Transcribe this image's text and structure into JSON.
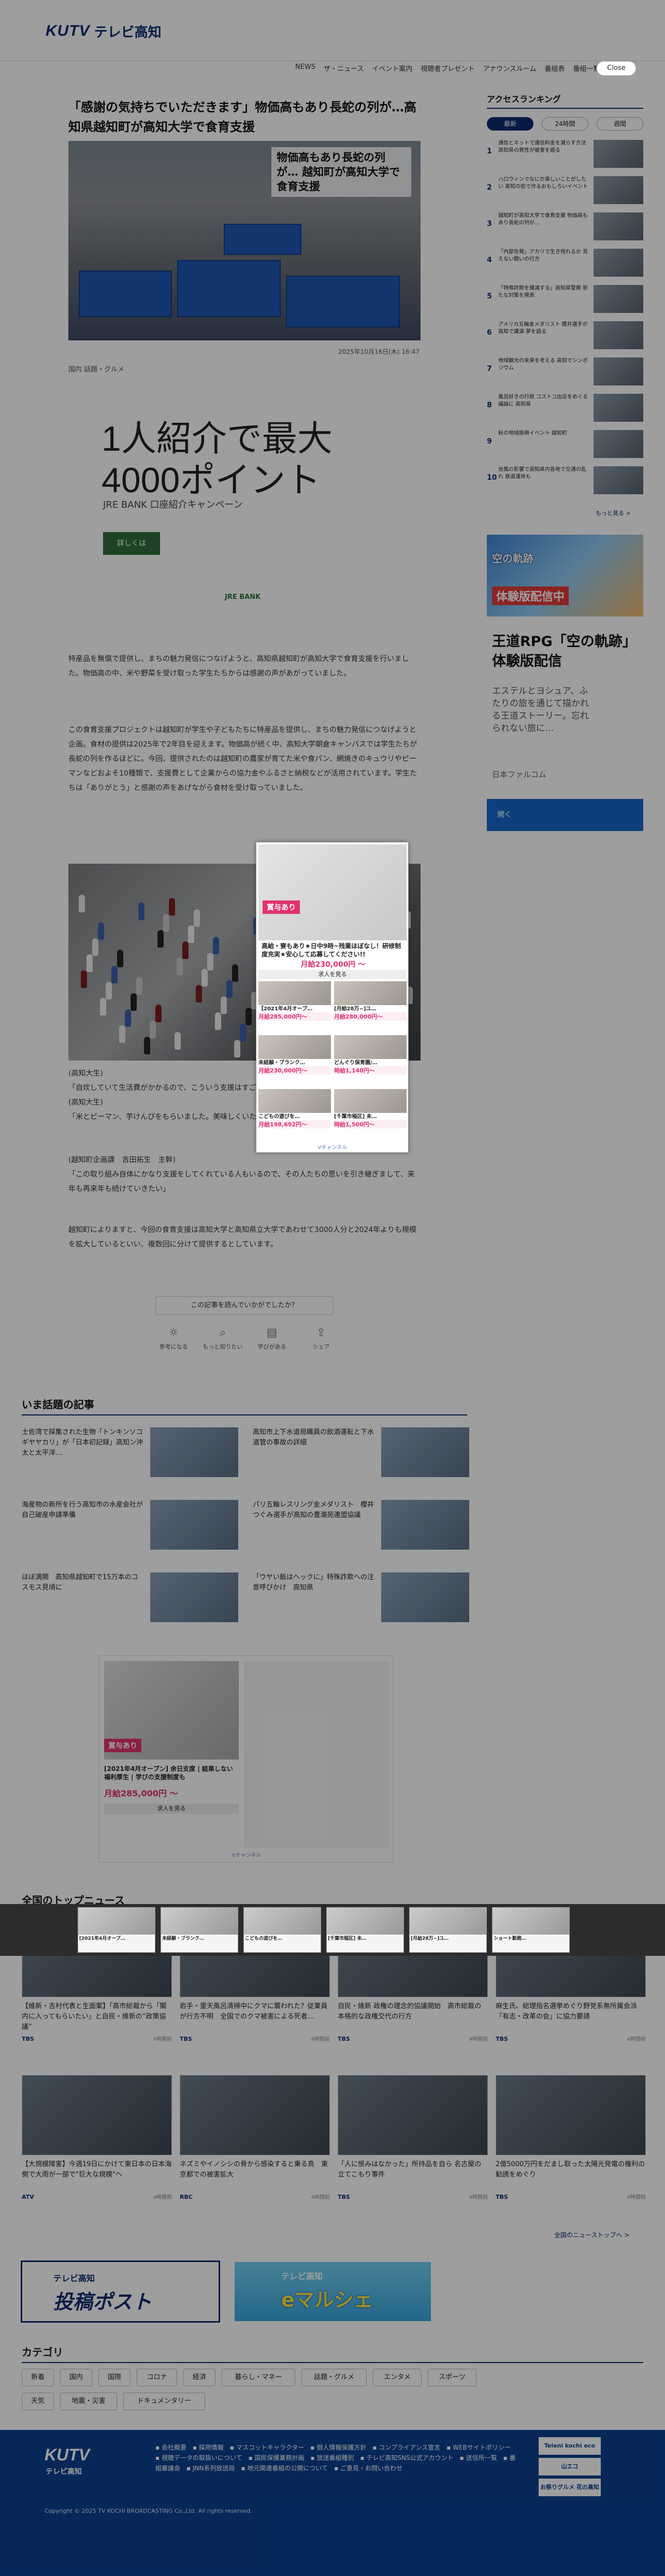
{
  "header": {
    "logo_kutv": "KUTV",
    "logo_name": "テレビ高知",
    "nav": [
      "NEWS",
      "ザ・ニュース",
      "イベント案内",
      "視聴者プレゼント",
      "アナウンスルーム",
      "番組表",
      "番組一覧"
    ],
    "close_label": "Close"
  },
  "article": {
    "title": "「感謝の気持ちでいただきます」物価高もあり長蛇の列が…高知県越知町が高知大学で食育支援",
    "hero_caption": "物価高もあり長蛇の列が… 越知町が高知大学で食育支援",
    "date": "2025年10月16日(木) 16:47",
    "category": "国内 話題・グルメ",
    "paragraphs": [
      "特産品を無償で提供し、まちの魅力発信につなげようと、高知県越知町が高知大学で食育支援を行いました。物価高の中、米や野菜を受け取った学生たちからは感謝の声があがっていました。",
      "この食育支援プロジェクトは越知町が学生や子どもたちに特産品を提供し、まちの魅力発信につなげようと企画。食材の提供は2025年で2年目を迎えます。物価高が続く中、高知大学朝倉キャンパスでは学生たちが長蛇の列を作るほどに。今回、提供されたのは越知町の農家が育てた米や食パン、網焼きのキュウリやピーマンなどおよそ10種類で、支援費として企業からの協力金やふるさと納税などが活用されています。学生たちは「ありがとう」と感謝の声をあげながら食材を受け取っていました。",
      "(高知大生)\n「自炊していて生活費がかかるので、こういう支援はすごく助かります」\n(高知大生)\n「米とピーマン、芋けんぴをもらいました。美味しくいただきます」",
      "(越知町企画課　吉田拓生　主幹)\n「この取り組み自体にかなり支援をしてくれている人もいるので、その人たちの思いを引き継ぎまして、来年も再来年も続けていきたい」",
      "越知町によりますと、今回の食育支援は高知大学と高知県立大学であわせて3000人分と2024年よりも規模を拡大しているといい、複数回に分けて提供するとしています。"
    ],
    "readmore": "この記事を読んでいかがでしたか？",
    "share": [
      "参考になる",
      "もっと知りたい",
      "学びがある",
      "シェア"
    ]
  },
  "ad_main": {
    "headline": "1人紹介で最大\n4000ポイント",
    "sub": "JRE BANK 口座紹介キャンペーン",
    "btn": "詳しくは",
    "foot": "JRE BANK"
  },
  "overlay_ad": {
    "tag": "賞与あり",
    "title": "高給・寮もあり★日中9時~残業ほぼなし！研修制度充実★安心して応募してください!!",
    "price": "月給230,000円 〜",
    "more": "求人を見る",
    "cells": [
      {
        "t": "【2021年4月オープ…",
        "p": "月給285,000円〜"
      },
      {
        "t": "[月給28万~]ユ…",
        "p": "月給280,000円〜"
      },
      {
        "t": "未経験・ブランク…",
        "p": "月給230,000円〜"
      },
      {
        "t": "どんぐり保育園/…",
        "p": "時給1,140円〜"
      },
      {
        "t": "こどもの遊びを…",
        "p": "月給198,692円〜"
      },
      {
        "t": "[千葉市稲区] 未…",
        "p": "時給1,500円〜"
      }
    ],
    "footer": "Vチャンネル"
  },
  "topics": {
    "heading": "いま話題の記事",
    "items": [
      "土佐湾で採集された生物「トンキンソコギヤヤカリ」が「日本初記録」高知ン沖太と太平洋…",
      "高知市上下水道局職員の飲酒運転と下水道管の事故の詳細",
      "海産物の新所を行う高知市の水産会社が自己破産申請準備",
      "パリ五輪レスリング金メダリスト　櫻井つぐみ選手が高知の豊潮苑連盟協議",
      "ほぼ満開　高知県越知町で15万本のコスモス見頃に",
      "「ウヤい飯はヘックに」特殊詐欺への注意呼びかけ　高知県"
    ]
  },
  "ad_second": {
    "tag": "賞与あり",
    "title": "[2021年4月オープン] 余日支度 | 結果しない福利厚生 | 学びの支援制度も",
    "price": "月給285,000円 〜",
    "more": "求人を見る",
    "footer": "Vチャンネル"
  },
  "ad_band": [
    "[2021年4月オープ…",
    "未経験・ブランク…",
    "こどもの遊びを…",
    "[千葉市稲区] 未…",
    "[月給28万~]ユ…",
    "ショート勤務…"
  ],
  "top_news": {
    "heading": "全国のトップニュース",
    "items": [
      {
        "t": "【維新・吉村代表と生面案】「高市総裁から「閣内に入ってもらいたい」と自民・維新の“政策協議”",
        "src": "TBS",
        "dt": "4時間前"
      },
      {
        "t": "岩手・霊天風呂清掃中にクマに襲われた？従業員が行方不明　全国でのクマ被害による死者…",
        "src": "TBS",
        "dt": "4時間前"
      },
      {
        "t": "自民・維新 政権の理念的協議開始　高市総裁の本格的な政権交代の行方",
        "src": "TBS",
        "dt": "4時間前"
      },
      {
        "t": "麻生氏、総理指名選挙めぐり野党系無所属会派「有志・改革の会」に協力要請",
        "src": "TBS",
        "dt": "4時間前"
      },
      {
        "t": "【大規模障害】今週19日にかけて東日本の日本海側で大雨が一部で\"巨大な規模\"へ",
        "src": "ATV",
        "dt": "4時間前"
      },
      {
        "t": "ネズミやイノシシの骨から感染すると乗る鳥　東京都での被害拡大",
        "src": "RBC",
        "dt": "4時間前"
      },
      {
        "t": "「人に恨みはなかった」所持品を自ら 名古屋の立てこもり事件",
        "src": "TBS",
        "dt": "4時間前"
      },
      {
        "t": "2億5000万円をだまし取った太陽光発電の権利の勧誘をめぐり",
        "src": "TBS",
        "dt": "4時間前"
      }
    ],
    "more": "全国のニューストップへ >"
  },
  "banners": {
    "b1_top": "テレビ高知",
    "b1_main": "投稿ポスト",
    "b2_top": "テレビ高知",
    "b2_main": "eマルシェ"
  },
  "categories": {
    "heading": "カテゴリ",
    "row1": [
      "新着",
      "国内",
      "国際",
      "コロナ",
      "経済",
      "暮らし・マネー",
      "話題・グルメ",
      "エンタメ",
      "スポーツ"
    ],
    "row2": [
      "天気",
      "地震・災害",
      "ドキュメンタリー"
    ]
  },
  "footer": {
    "logo": "KUTV",
    "logo_sub": "テレビ高知",
    "links": [
      "会社概要",
      "採用情報",
      "マスコットキャラクター",
      "個人情報保護方針",
      "コンプライアンス宣言",
      "WEBサイトポリシー",
      "視聴データの取扱いについて",
      "国民保護業務計画",
      "放送番組種別",
      "テレビ高知SNS公式アカウント",
      "送信所一覧",
      "番組審議会",
      "JNN系列放送局",
      "地元関連番組の公開について",
      "ご意見・お問い合わせ"
    ],
    "badge1": "Teleni kochi eco",
    "badge2": "山エコ",
    "badge3": "お祭りグルメ 花の高知",
    "copy": "Copyright © 2025 TV KOCHI BROADCASTING Co.,Ltd. All rights reserved."
  },
  "sidebar": {
    "ranking_title": "アクセスランキング",
    "tabs": [
      "最新",
      "24時間",
      "週間"
    ],
    "ranks": [
      "通信とネットで通信料金を減らす方法 高知県の男性が被害を語る",
      "ハロウィンでなにか楽しいことがしたい 高知の街で作るおもしろいイベント",
      "越知町が高知大学で食育支援 物価高もあり長蛇の列が…",
      "「内部告発」アカリで生き残れるか 見えない闘いの行方",
      "「特殊詐欺を撲滅する」高知県警察 新たな対策を発表",
      "アメリカ五輪金メダリスト 櫻井選手が高知で講演 夢を語る",
      "地域観光の未来を考える 高知でシンポジウム",
      "風呂好きの行政 コストコ出店をめぐる議論に 高知県",
      "秋の地域振興イベント 越知町",
      "台風の影響で高知県内各地で交通の乱れ 鉄道運休も"
    ],
    "more": "もっと見る >",
    "ad": {
      "vis1": "空の軌跡",
      "vis2": "体験版配信中",
      "headline": "王道RPG「空の軌跡」体験版配信",
      "desc": "エステルとヨシュア、ふたりの旅を通じて描かれる王道ストーリー。忘れられない旅に…",
      "company": "日本ファルコム",
      "go": "開く"
    }
  }
}
